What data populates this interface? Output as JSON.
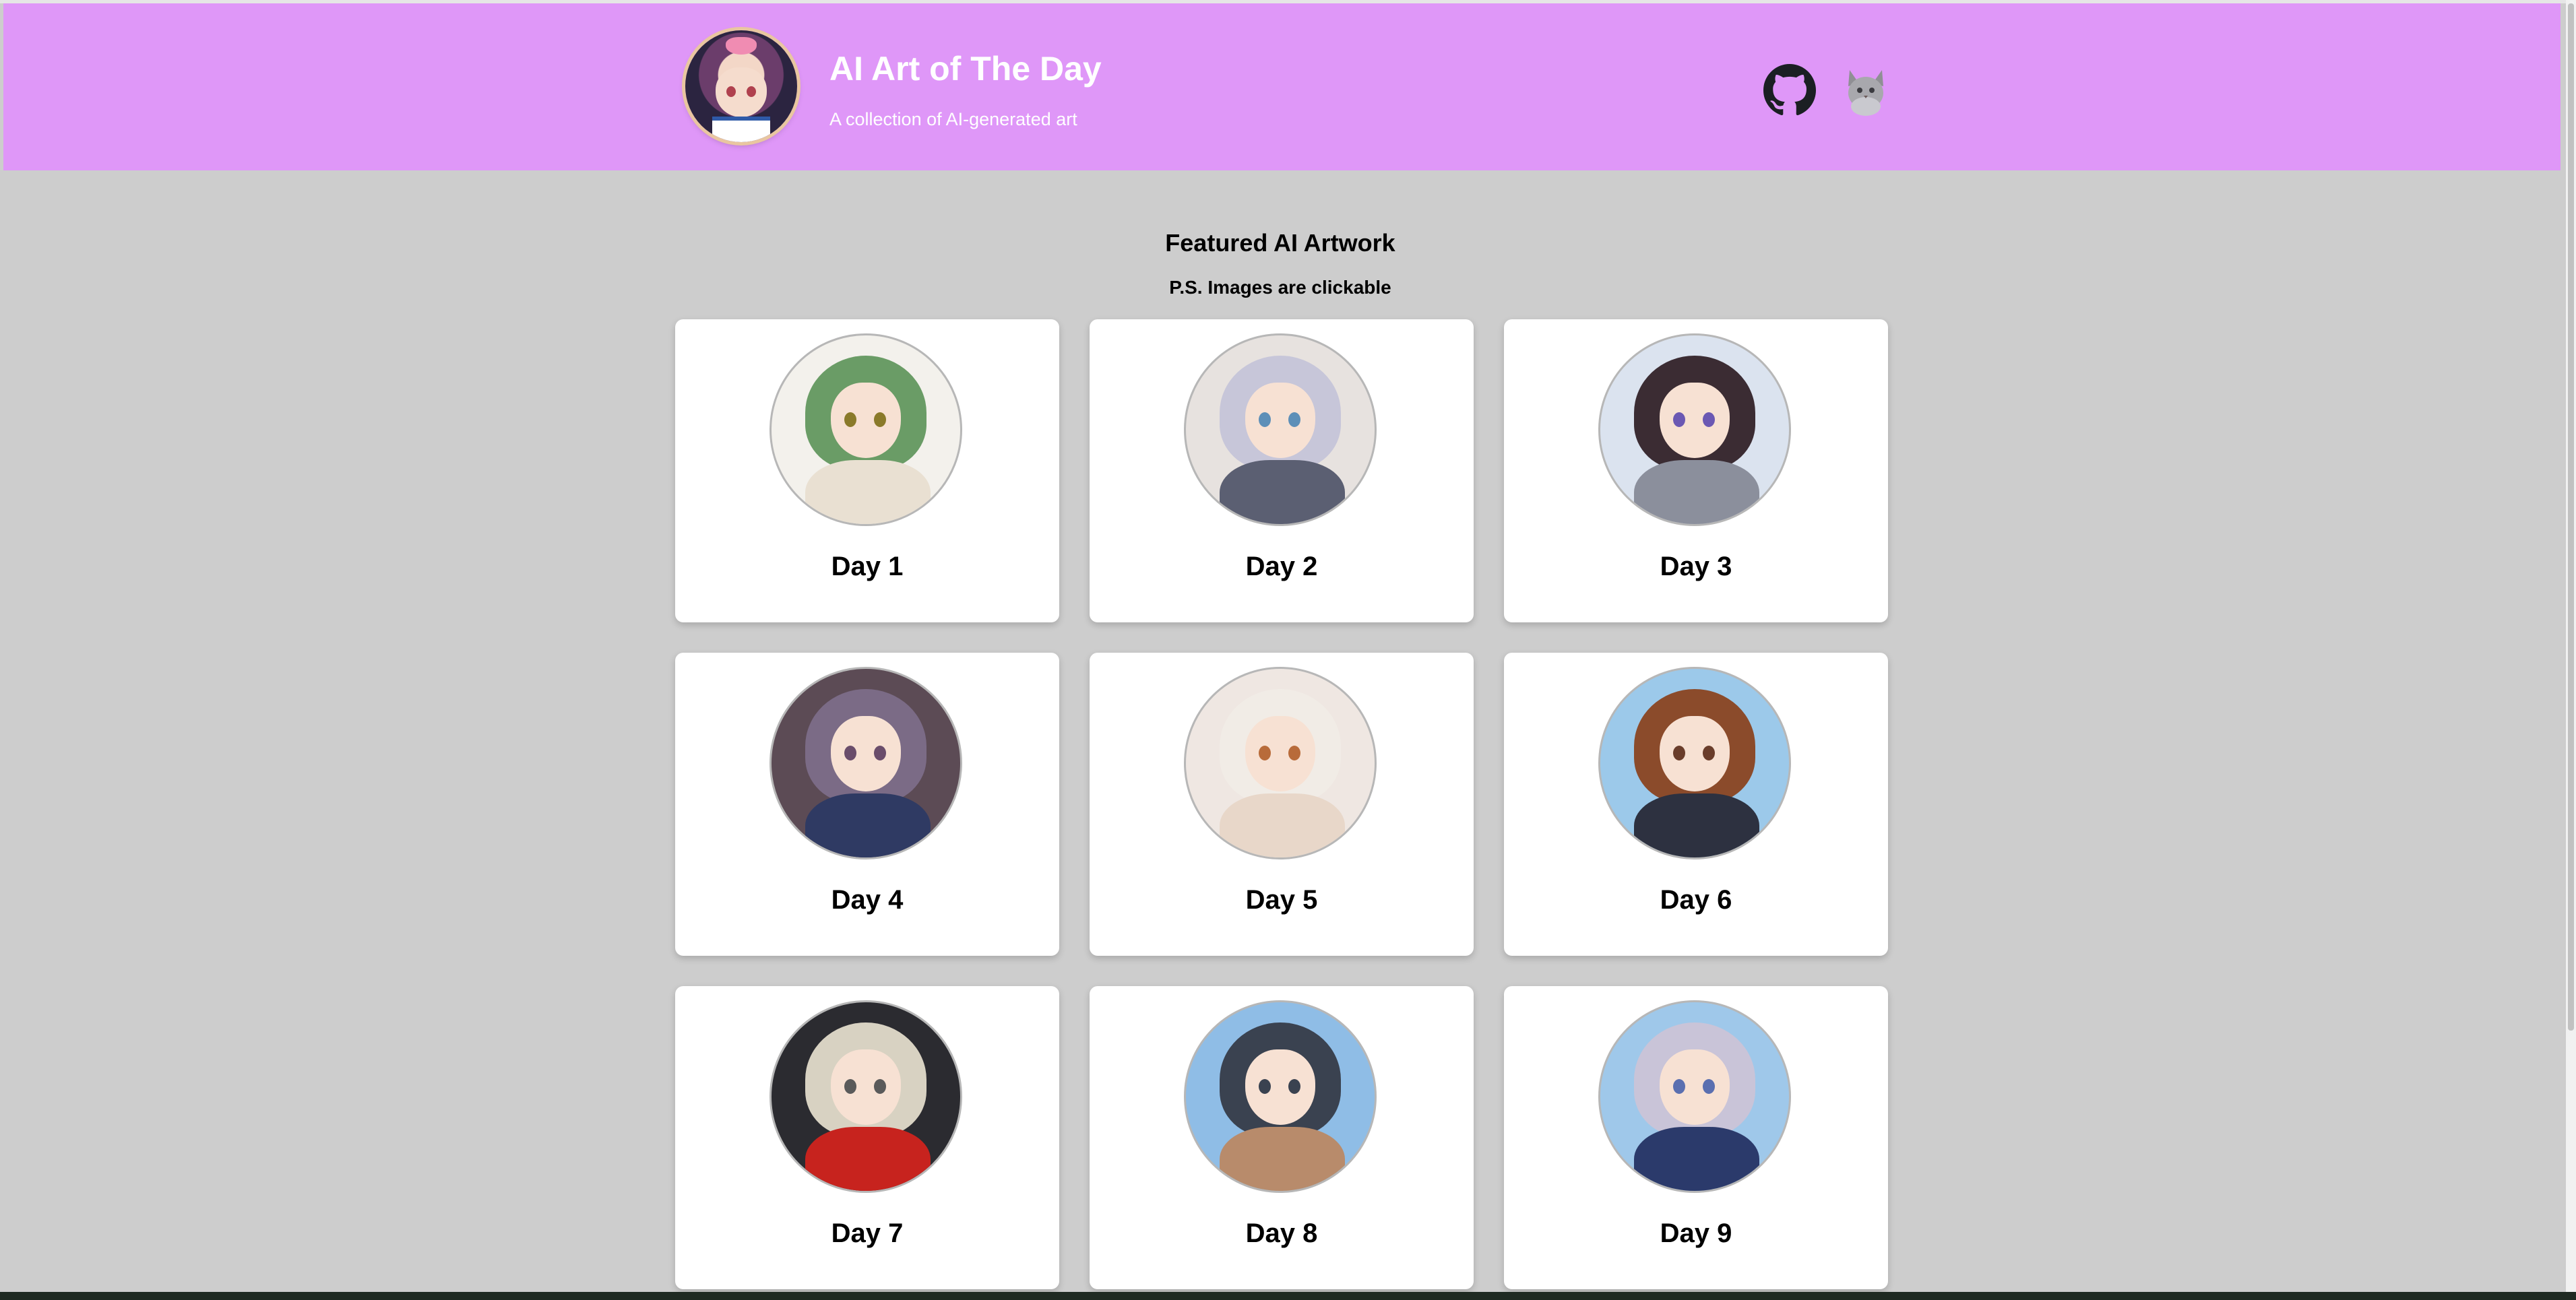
{
  "header": {
    "title": "AI Art of The Day",
    "subtitle": "A collection of AI-generated art",
    "logo_icon": "anime-girl-avatar-logo",
    "github_icon": "github-icon",
    "cat_icon": "cat-avatar-icon",
    "background_color": "#df97f8"
  },
  "featured": {
    "title": "Featured AI Artwork",
    "note": "P.S. Images are clickable"
  },
  "gallery": [
    {
      "label": "Day 1",
      "hair": "#6a9c66",
      "eye": "#8a7a2a",
      "body": "#e9e0d2",
      "bg": "#f3f1ec"
    },
    {
      "label": "Day 2",
      "hair": "#c7c6d9",
      "eye": "#5d8fb8",
      "body": "#5b5f72",
      "bg": "#e7e2df"
    },
    {
      "label": "Day 3",
      "hair": "#3b2c33",
      "eye": "#6b58b3",
      "body": "#8b8f9c",
      "bg": "#dbe3ef"
    },
    {
      "label": "Day 4",
      "hair": "#7b6b86",
      "eye": "#6a4d6b",
      "body": "#2f3a63",
      "bg": "#5c4b55"
    },
    {
      "label": "Day 5",
      "hair": "#f1ece6",
      "eye": "#b86b3a",
      "body": "#e8d7c9",
      "bg": "#efe7e2"
    },
    {
      "label": "Day 6",
      "hair": "#8b4b2b",
      "eye": "#6a3d2b",
      "body": "#2d3140",
      "bg": "#9cc9ea"
    },
    {
      "label": "Day 7",
      "hair": "#d8d2c2",
      "eye": "#5a5a5a",
      "body": "#c7231e",
      "bg": "#2b2b30"
    },
    {
      "label": "Day 8",
      "hair": "#3a4250",
      "eye": "#3a4250",
      "body": "#b88b6b",
      "bg": "#8fbde6"
    },
    {
      "label": "Day 9",
      "hair": "#c9c4d8",
      "eye": "#5a6fb0",
      "body": "#2b3a6b",
      "bg": "#9fc8ea"
    }
  ]
}
